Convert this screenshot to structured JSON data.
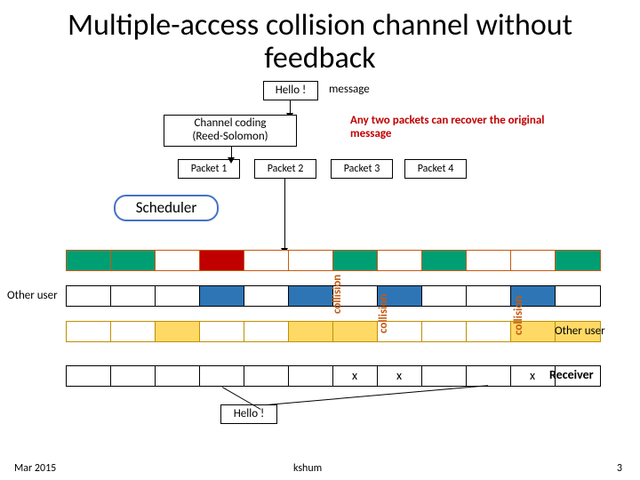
{
  "title": "Multiple-access collision channel without feedback",
  "hello": "Hello !",
  "message_label": "message",
  "coding": "Channel coding\n(Reed-Solomon)",
  "recover": "Any two packets can recover the original message",
  "packets": [
    "Packet 1",
    "Packet 2",
    "Packet 3",
    "Packet 4"
  ],
  "scheduler": "Scheduler",
  "other_user": "Other user",
  "collision": "collision",
  "receiver": "Receiver",
  "x": "x",
  "timelines": {
    "t1": [
      "g",
      "g",
      "",
      "r",
      "",
      "",
      "g",
      "",
      "g",
      "",
      "",
      "g"
    ],
    "t2": [
      "",
      "",
      "",
      "b",
      "",
      "b",
      "",
      "b",
      "",
      "",
      "b",
      ""
    ],
    "t3": [
      "",
      "",
      "y",
      "",
      "",
      "y",
      "y",
      "",
      "",
      "",
      "y",
      "y"
    ],
    "rx": [
      "",
      "",
      "",
      "",
      "",
      "",
      "x",
      "x",
      "",
      "",
      "x",
      ""
    ]
  },
  "footer": {
    "left": "Mar 2015",
    "center": "kshum",
    "right": "3"
  }
}
